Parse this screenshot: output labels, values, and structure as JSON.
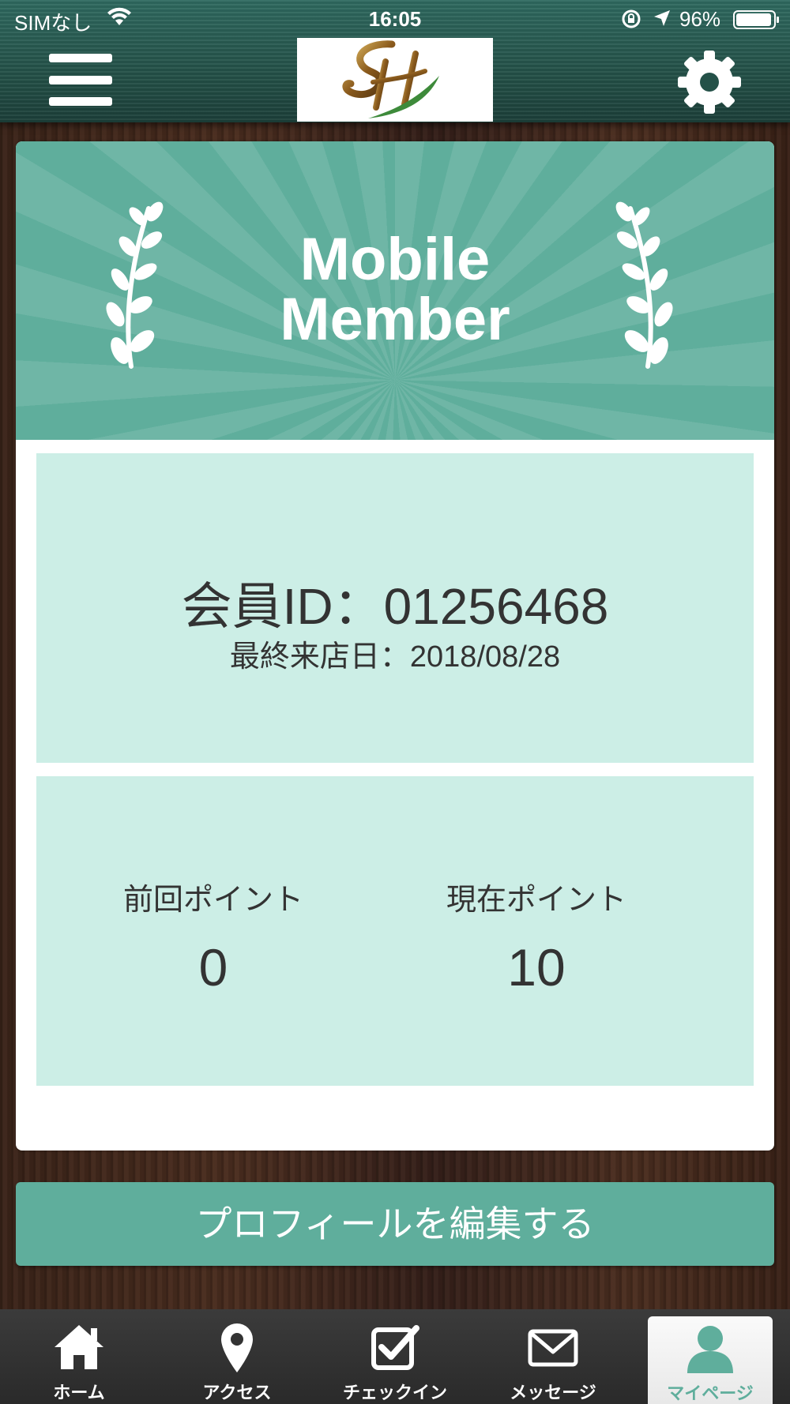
{
  "status_bar": {
    "carrier": "SIMなし",
    "time": "16:05",
    "battery_percent": "96%",
    "battery_level": 0.96
  },
  "header": {
    "menu_icon": "hamburger-menu-icon",
    "settings_icon": "gear-icon",
    "logo": "SH"
  },
  "banner": {
    "title_line1": "Mobile",
    "title_line2": "Member"
  },
  "member": {
    "id_line": "会員ID：01256468",
    "last_visit_line": "最終来店日：2018/08/28"
  },
  "points": {
    "previous_label": "前回ポイント",
    "previous_value": "0",
    "current_label": "現在ポイント",
    "current_value": "10"
  },
  "edit_profile_label": "プロフィールを編集する",
  "tabs": [
    {
      "label": "ホーム",
      "icon": "home-icon"
    },
    {
      "label": "アクセス",
      "icon": "map-pin-icon"
    },
    {
      "label": "チェックイン",
      "icon": "checkbox-icon"
    },
    {
      "label": "メッセージ",
      "icon": "envelope-icon"
    },
    {
      "label": "マイページ",
      "icon": "person-icon"
    }
  ],
  "colors": {
    "accent": "#5fae9c",
    "panel": "#cceee6",
    "header": "#245148"
  }
}
